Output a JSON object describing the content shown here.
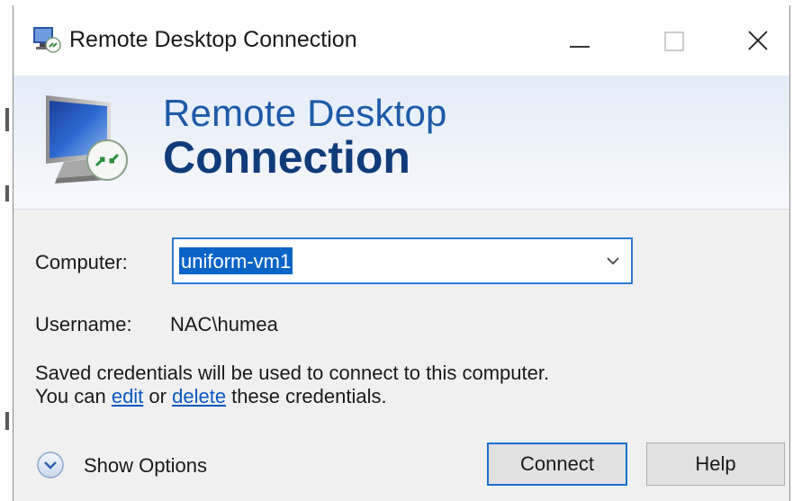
{
  "window": {
    "title": "Remote Desktop Connection",
    "controls": {
      "minimize": "minimize",
      "maximize": "maximize",
      "close": "close"
    }
  },
  "banner": {
    "line1": "Remote Desktop",
    "line2": "Connection"
  },
  "form": {
    "computer_label": "Computer:",
    "computer_value": "uniform-vm1",
    "username_label": "Username:",
    "username_value": "NAC\\humea"
  },
  "credentials": {
    "line1": "Saved credentials will be used to connect to this computer.",
    "line2_prefix": "You can ",
    "edit_link": "edit",
    "line2_middle": " or ",
    "delete_link": "delete",
    "line2_suffix": " these credentials."
  },
  "footer": {
    "show_options_label": "Show Options",
    "connect_label": "Connect",
    "help_label": "Help"
  },
  "icons": {
    "title": "remote-desktop-icon",
    "banner": "monitor-remote-icon",
    "dropdown": "chevron-down-icon",
    "options": "expand-circle-icon"
  },
  "colors": {
    "accent": "#2d7bd1",
    "banner_text": "#1e5aa8",
    "banner_title": "#113b7a",
    "link": "#0b57c4",
    "selection": "#0a64c8"
  }
}
